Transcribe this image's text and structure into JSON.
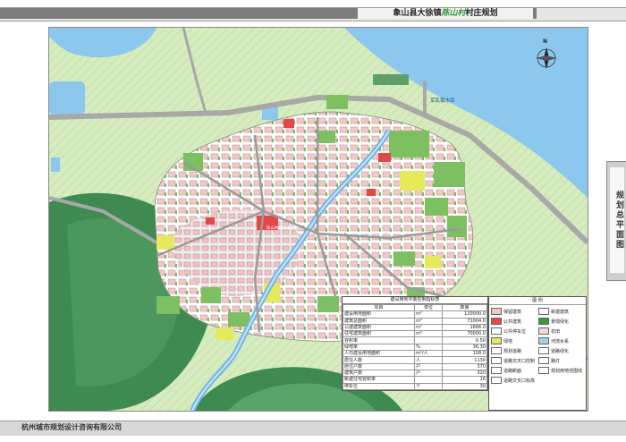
{
  "header": {
    "title_prefix": "象山县大徐镇",
    "title_highlight": "陈山村",
    "title_suffix": "村庄规划"
  },
  "side_tab": {
    "label": "规划总平面图"
  },
  "footer": {
    "company": "杭州城市规划设计咨询有限公司"
  },
  "map": {
    "reservoir_label": "军民镇水库",
    "north_label": "N",
    "village_center_label": "陈山村村民委员会"
  },
  "stats_table": {
    "caption": "建设用地平衡控制指标表",
    "headers": [
      "项目",
      "单位",
      "数量"
    ],
    "rows": [
      {
        "c0": "建设用地面积",
        "c1": "m²",
        "c2": "120000.0"
      },
      {
        "c0": "建筑总面积",
        "c1": "m²",
        "c2": "71004.0"
      },
      {
        "c0": "公建建筑面积",
        "c1": "m²",
        "c2": "1666.0"
      },
      {
        "c0": "住宅建筑面积",
        "c1": "m²",
        "c2": "70000.0"
      },
      {
        "c0": "容积率",
        "c1": "",
        "c2": "0.50"
      },
      {
        "c0": "绿地率",
        "c1": "%",
        "c2": "36.30"
      },
      {
        "c0": "人均建设用地面积",
        "c1": "m²/人",
        "c2": "108.0"
      },
      {
        "c0": "居住人数",
        "c1": "人",
        "c2": "1130"
      },
      {
        "c0": "居住户数",
        "c1": "户",
        "c2": "370"
      },
      {
        "c0": "建筑户数",
        "c1": "户",
        "c2": "320"
      },
      {
        "c0": "新建住宅容积率",
        "c1": "",
        "c2": "16"
      },
      {
        "c0": "停车位",
        "c1": "个",
        "c2": "30"
      }
    ],
    "side_label": "其中"
  },
  "legend": {
    "caption": "图 例",
    "items": [
      {
        "label": "保留建筑",
        "color": "#f4c6c6"
      },
      {
        "label": "新建建筑",
        "color": "#ffffff"
      },
      {
        "label": "公共建筑",
        "color": "#e84a4a"
      },
      {
        "label": "景观绿化",
        "color": "#3a9a3a"
      },
      {
        "label": "公共停车位",
        "color": "#ffffff"
      },
      {
        "label": "农田",
        "color": "#f7d6d6"
      },
      {
        "label": "绿地",
        "color": "#e8e860"
      },
      {
        "label": "河流水系",
        "color": "#9fd4f0"
      },
      {
        "label": "规划道路",
        "color": "#ffffff"
      },
      {
        "label": "道路绿化",
        "color": "#ffffff"
      },
      {
        "label": "道路交叉口控制",
        "color": "#ffffff"
      },
      {
        "label": "路灯",
        "color": "#ffffff"
      },
      {
        "label": "道路断面",
        "color": "#ffffff"
      },
      {
        "label": "规划用地范围线",
        "color": "#ffffff"
      },
      {
        "label": "道路交叉口标高",
        "color": "#ffffff"
      }
    ]
  },
  "colors": {
    "water": "#8cc8ee",
    "mountain_dark": "#3e8a50",
    "field_light": "#dcefc6",
    "field_green": "#7cc061",
    "road": "#a8a8a8",
    "building": "#f5c8c8",
    "public_building": "#e24848",
    "yellow_green": "#e4ea5a"
  }
}
